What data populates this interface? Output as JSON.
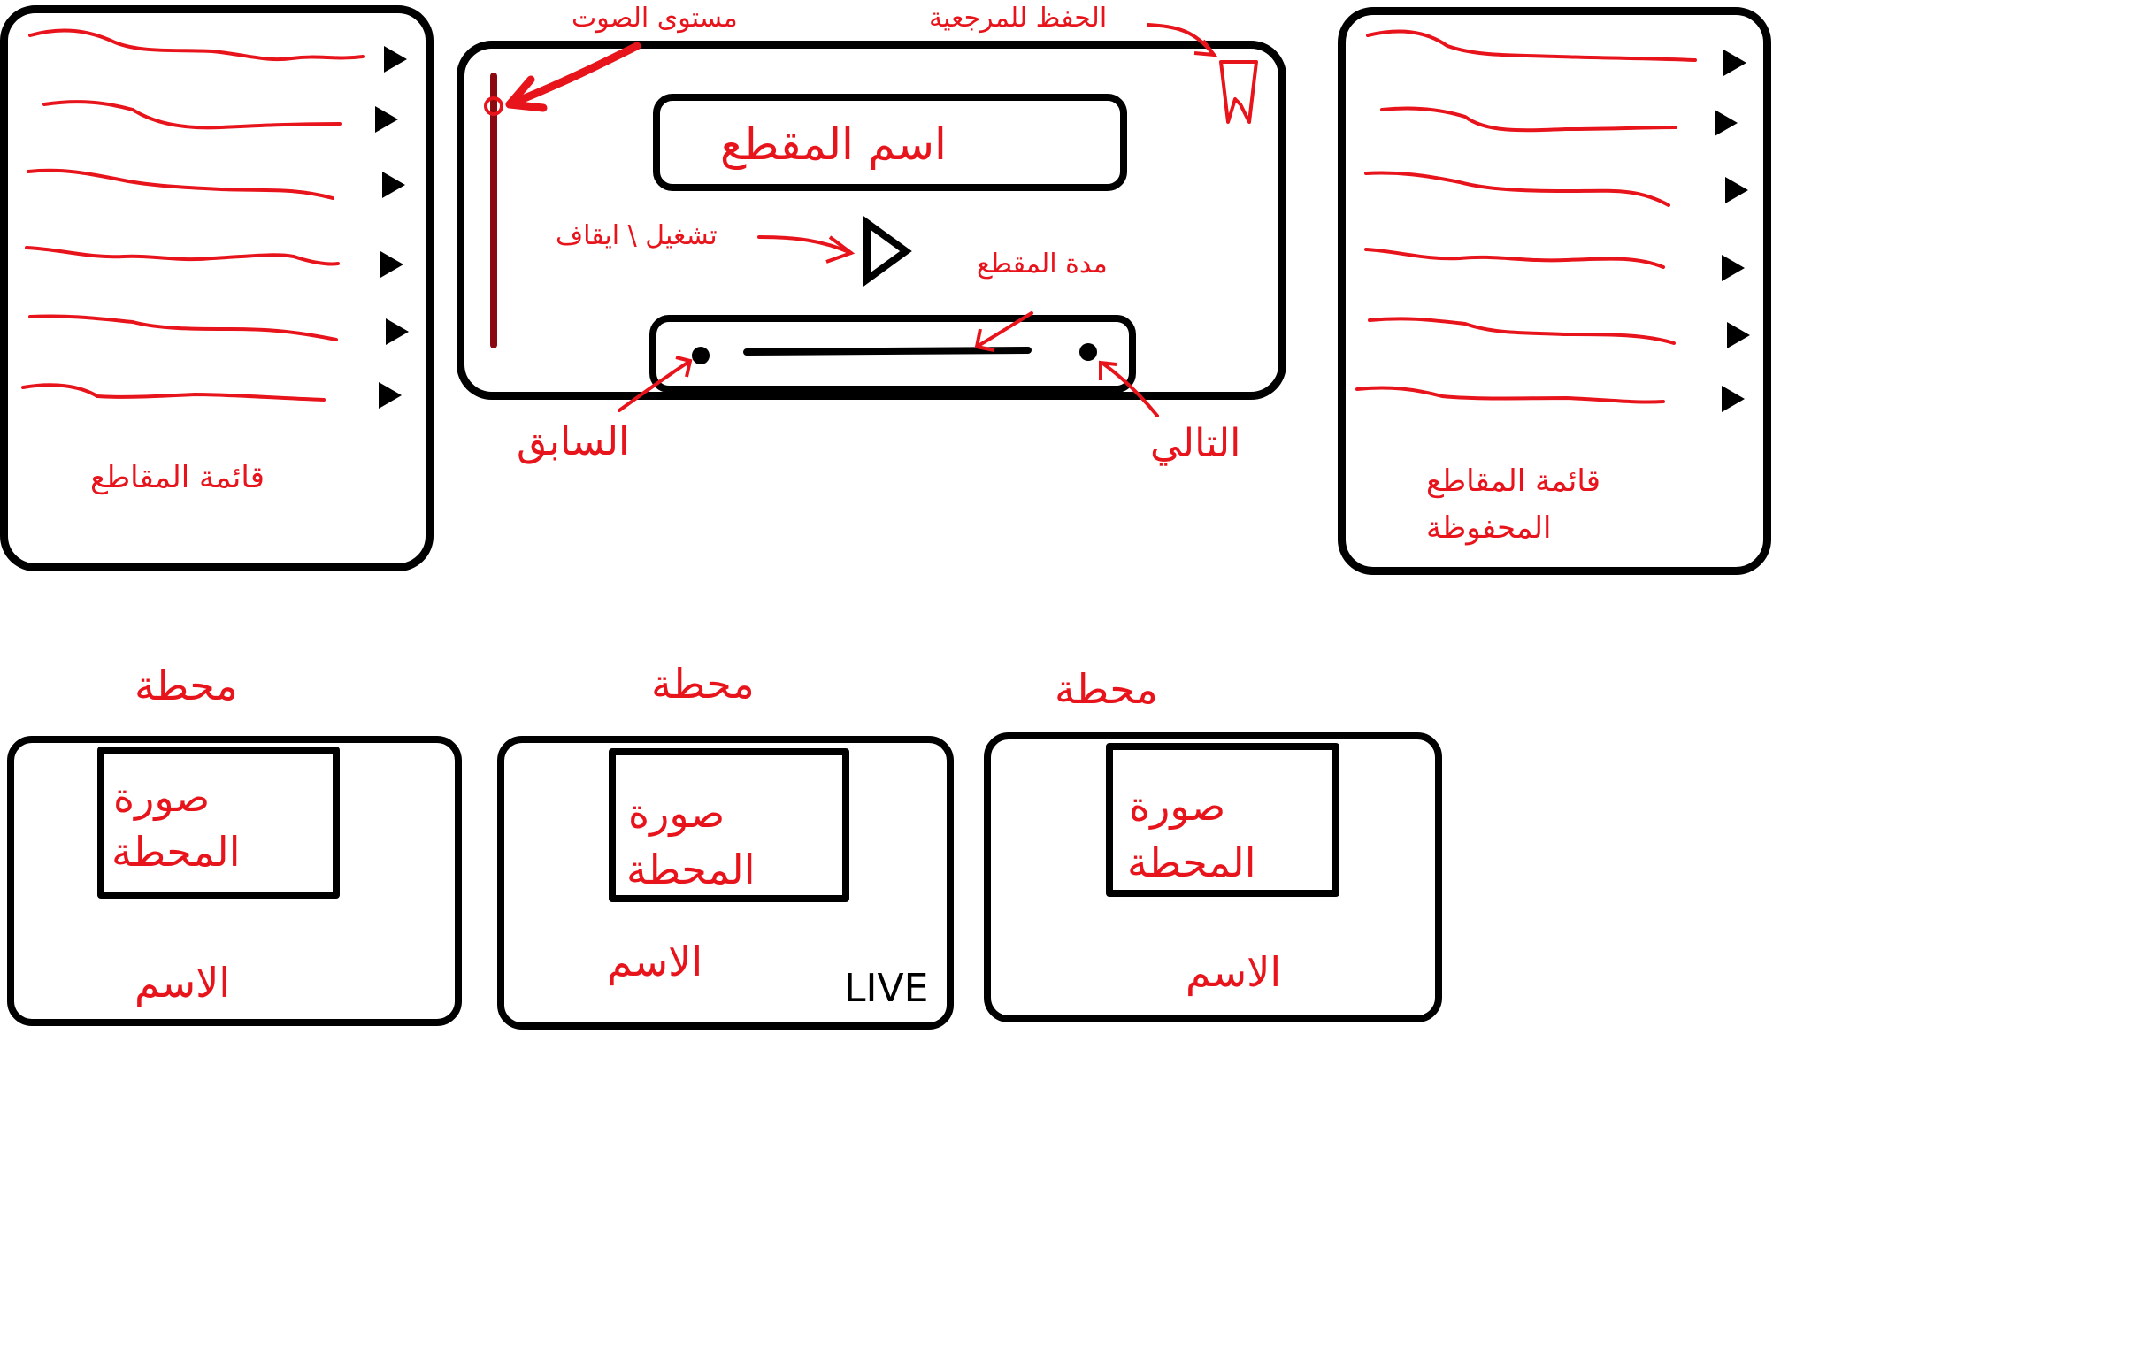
{
  "colors": {
    "ink": "#000000",
    "accent": "#e8141c",
    "volume": "#8b0a12"
  },
  "playlist_panel": {
    "label": "قائمة المقاطع",
    "rows": 6,
    "row_icon": "play-arrow-icon"
  },
  "saved_panel": {
    "label_line1": "قائمة المقاطع",
    "label_line2": "المحفوظة",
    "rows": 6,
    "row_icon": "play-arrow-icon"
  },
  "player": {
    "track_name": "اسم المقطع",
    "annotation_volume": "مستوى الصوت",
    "annotation_bookmark": "الحفظ للمرجعية",
    "annotation_play_pause": "تشغيل \\ ايقاف",
    "annotation_duration": "مدة المقطع",
    "annotation_previous": "السابق",
    "annotation_next": "التالي",
    "icons": [
      "bookmark-icon",
      "play-icon",
      "volume-slider",
      "progress-bar"
    ]
  },
  "stations": [
    {
      "heading": "محطة",
      "image_line1": "صورة",
      "image_line2": "المحطة",
      "name": "الاسم",
      "badge": ""
    },
    {
      "heading": "محطة",
      "image_line1": "صورة",
      "image_line2": "المحطة",
      "name": "الاسم",
      "badge": "LIVE"
    },
    {
      "heading": "محطة",
      "image_line1": "صورة",
      "image_line2": "المحطة",
      "name": "الاسم",
      "badge": ""
    }
  ]
}
